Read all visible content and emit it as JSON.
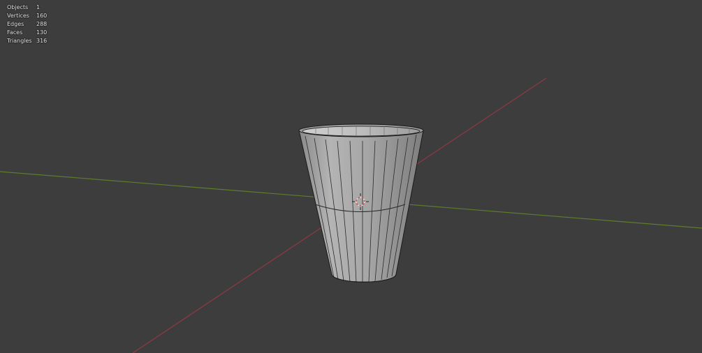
{
  "viewport": {
    "background_color": "#3d3d3d",
    "x_axis_color": "#8e3a45",
    "y_axis_color": "#5d7d2c",
    "mesh_color": "#a9a9a9",
    "wire_color": "#1a1a1a"
  },
  "statistics": {
    "rows": [
      {
        "label": "Objects",
        "value": "1"
      },
      {
        "label": "Vertices",
        "value": "160"
      },
      {
        "label": "Edges",
        "value": "288"
      },
      {
        "label": "Faces",
        "value": "130"
      },
      {
        "label": "Triangles",
        "value": "316"
      }
    ]
  },
  "icons": {
    "cursor": "3d-cursor-icon"
  }
}
